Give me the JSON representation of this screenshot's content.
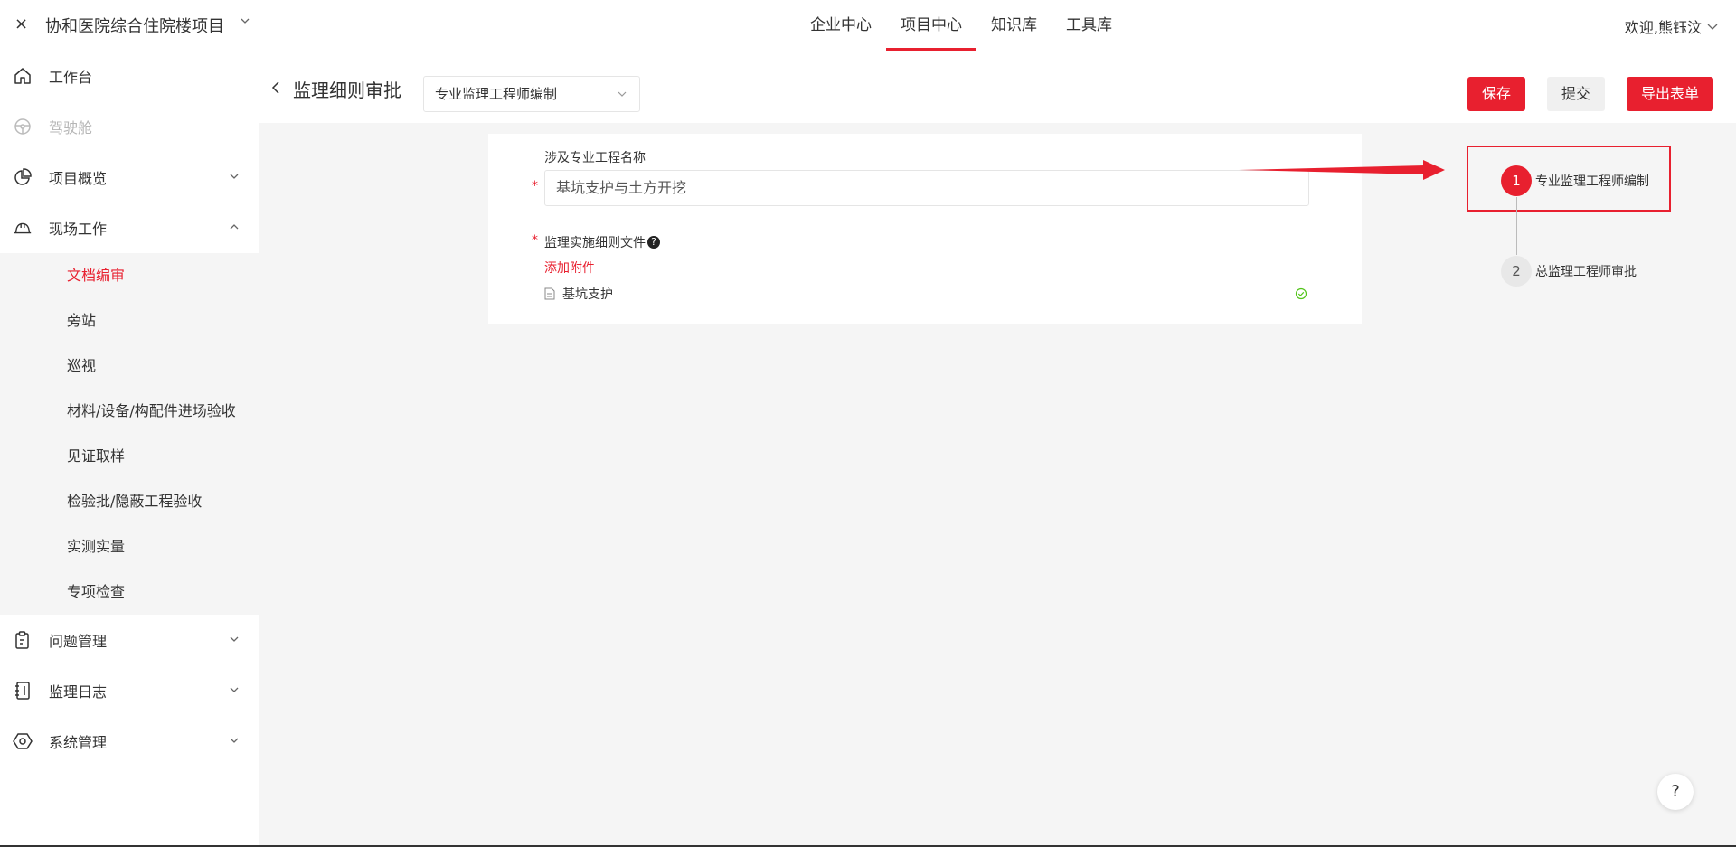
{
  "topbar": {
    "close_glyph": "×",
    "project_name": "协和医院综合住院楼项目",
    "nav": [
      {
        "label": "企业中心",
        "active": false
      },
      {
        "label": "项目中心",
        "active": true
      },
      {
        "label": "知识库",
        "active": false
      },
      {
        "label": "工具库",
        "active": false
      }
    ],
    "welcome": "欢迎,熊钰汶"
  },
  "sidebar": {
    "items": [
      {
        "label": "工作台",
        "icon": "home-icon"
      },
      {
        "label": "驾驶舱",
        "icon": "steering-wheel-icon",
        "disabled": true
      },
      {
        "label": "项目概览",
        "icon": "pie-chart-icon",
        "expandable": true
      },
      {
        "label": "现场工作",
        "icon": "helmet-icon",
        "expanded": true
      },
      {
        "label": "问题管理",
        "icon": "clipboard-icon",
        "expandable": true
      },
      {
        "label": "监理日志",
        "icon": "notebook-icon",
        "expandable": true
      },
      {
        "label": "系统管理",
        "icon": "settings-hex-icon",
        "expandable": true
      }
    ],
    "sub_items": [
      {
        "label": "文档编审",
        "active": true
      },
      {
        "label": "旁站"
      },
      {
        "label": "巡视"
      },
      {
        "label": "材料/设备/构配件进场验收"
      },
      {
        "label": "见证取样"
      },
      {
        "label": "检验批/隐蔽工程验收"
      },
      {
        "label": "实测实量"
      },
      {
        "label": "专项检查"
      }
    ]
  },
  "header": {
    "title": "监理细则审批",
    "select_value": "专业监理工程师编制",
    "save_label": "保存",
    "submit_label": "提交",
    "export_label": "导出表单"
  },
  "form": {
    "field1_label": "涉及专业工程名称",
    "field1_value": "基坑支护与土方开挖",
    "field2_label": "监理实施细则文件",
    "add_attachment": "添加附件",
    "file_name": "基坑支护",
    "required_mark": "*"
  },
  "steps": [
    {
      "num": "1",
      "label": "专业监理工程师编制",
      "status": "active"
    },
    {
      "num": "2",
      "label": "总监理工程师审批",
      "status": "wait"
    }
  ],
  "help_glyph": "?",
  "colors": {
    "accent": "#e8202f",
    "bg": "#f5f5f5"
  }
}
